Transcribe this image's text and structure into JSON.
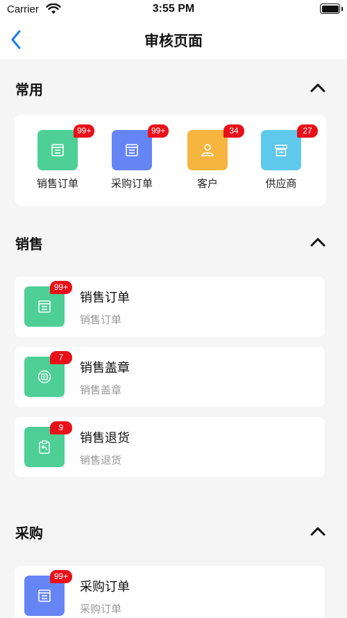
{
  "status_bar": {
    "carrier": "Carrier",
    "time": "3:55 PM"
  },
  "nav": {
    "title": "审核页面"
  },
  "sections": {
    "common": {
      "title": "常用"
    },
    "sales": {
      "title": "销售"
    },
    "purchase": {
      "title": "采购"
    }
  },
  "common_items": [
    {
      "label": "销售订单",
      "badge": "99+",
      "color": "#4dcf96",
      "icon": "document-icon"
    },
    {
      "label": "采购订单",
      "badge": "99+",
      "color": "#6685f5",
      "icon": "document-icon"
    },
    {
      "label": "客户",
      "badge": "34",
      "color": "#f5b53f",
      "icon": "person-icon"
    },
    {
      "label": "供应商",
      "badge": "27",
      "color": "#5fc9ec",
      "icon": "store-icon"
    }
  ],
  "sales_items": [
    {
      "title": "销售订单",
      "subtitle": "销售订单",
      "badge": "99+",
      "color": "#4dcf96",
      "icon": "document-icon"
    },
    {
      "title": "销售盖章",
      "subtitle": "销售盖章",
      "badge": "7",
      "color": "#4dcf96",
      "icon": "stamp-icon"
    },
    {
      "title": "销售退货",
      "subtitle": "销售退货",
      "badge": "9",
      "color": "#4dcf96",
      "icon": "return-clipboard-icon"
    }
  ],
  "purchase_items": [
    {
      "title": "采购订单",
      "subtitle": "采购订单",
      "badge": "99+",
      "color": "#6685f5",
      "icon": "document-icon"
    }
  ],
  "colors": {
    "badge": "#e8111a",
    "accent": "#1a7cf0",
    "background": "#f5f5f6"
  }
}
